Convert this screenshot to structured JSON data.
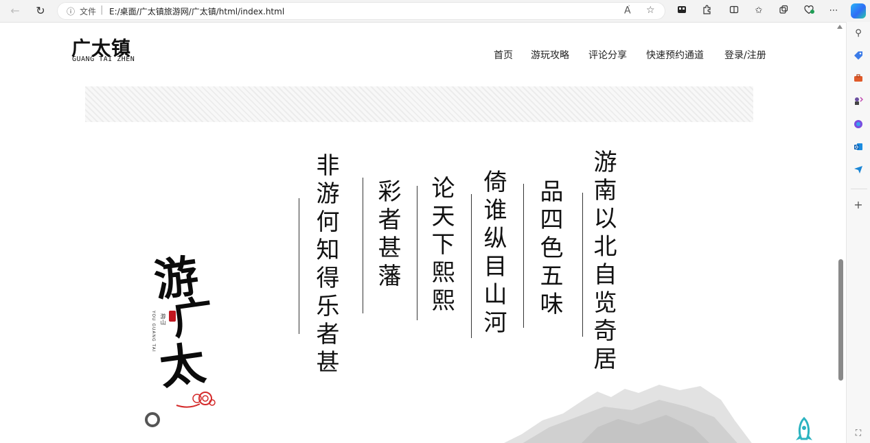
{
  "browser": {
    "info_label": "文件",
    "url": "E:/桌面/广太镇旅游网/广太镇/html/index.html",
    "read_aloud_label": "A",
    "read_aloud_superscript": "̀"
  },
  "site": {
    "logo_cn": "广太镇",
    "logo_en": "GUANG TAI ZHEN",
    "nav": [
      "首页",
      "游玩攻略",
      "评论分享",
      "快速预约通道",
      "登录/注册"
    ]
  },
  "poem": {
    "columns": [
      "游南以北自览奇居",
      "品四色五味",
      "倚谁纵目山河",
      "论天下熙熙",
      "彩者甚藩",
      "非游何知得乐者甚"
    ]
  },
  "calligraphy": {
    "chars": [
      "游",
      "广",
      "太"
    ],
    "vertical_pinyin": "YOU GUANG TAI",
    "vertical_cn": "游山"
  },
  "colors": {
    "seal_red": "#c0161f",
    "cloud_red": "#d42a2a",
    "rocket_teal": "#2bb3c0"
  }
}
